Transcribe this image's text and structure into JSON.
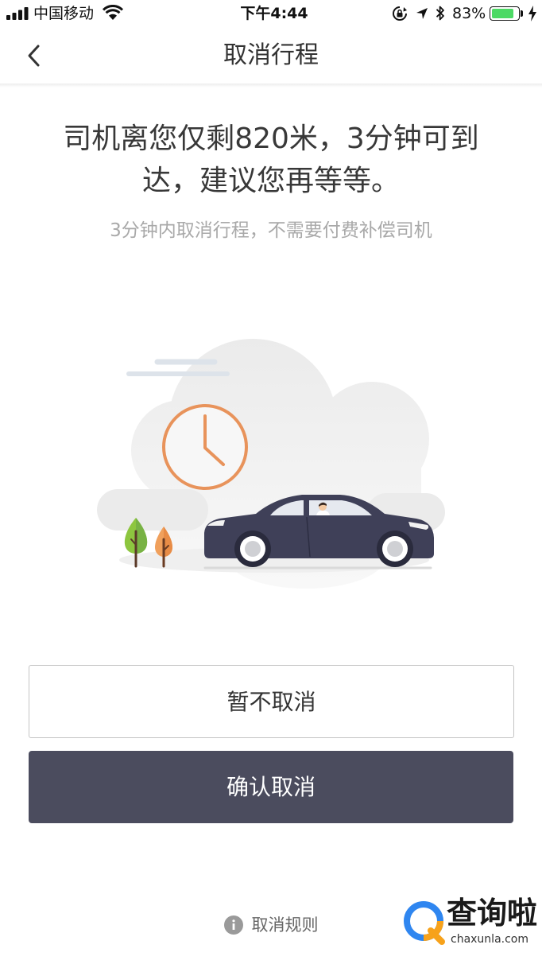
{
  "status_bar": {
    "carrier": "中国移动",
    "time": "下午4:44",
    "battery_text": "83%",
    "battery_level": 0.83,
    "icons": [
      "signal-icon",
      "wifi-icon",
      "rotation-lock-icon",
      "location-arrow-icon",
      "bluetooth-icon",
      "battery-icon",
      "charging-bolt-icon"
    ]
  },
  "nav": {
    "title": "取消行程",
    "back_icon": "chevron-left-icon"
  },
  "message": {
    "headline_lines": [
      "司机离您仅剩820米，3分钟可到",
      "达，建议您再等等。"
    ],
    "subtext": "3分钟内取消行程，不需要付费补偿司机"
  },
  "illustration": {
    "icons": [
      "cloud-icon",
      "clock-icon",
      "tree-icon",
      "car-icon"
    ]
  },
  "actions": {
    "keep_label": "暂不取消",
    "confirm_label": "确认取消"
  },
  "footer": {
    "rules_label": "取消规则",
    "icon": "info-icon"
  },
  "watermark": {
    "brand": "查询啦",
    "domain": "chaxunla.com"
  },
  "colors": {
    "accent": "#e8935b",
    "car": "#3f4058",
    "confirm_button": "#4b4c5e",
    "battery": "#4cd964",
    "tree_green": "#8dc63f",
    "tree_orange": "#f0a05c"
  }
}
